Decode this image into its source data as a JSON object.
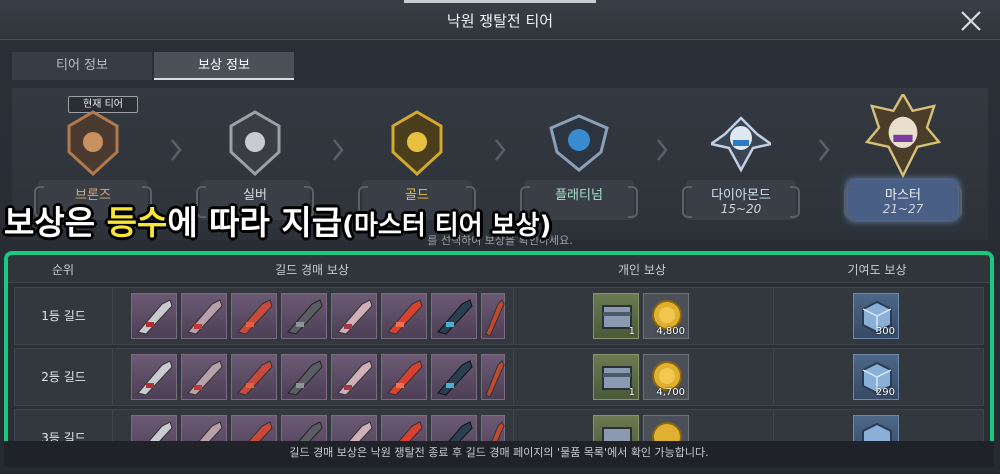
{
  "window": {
    "title": "낙원 쟁탈전 티어"
  },
  "tabs": [
    {
      "label": "티어 정보",
      "active": false
    },
    {
      "label": "보상 정보",
      "active": true
    }
  ],
  "tiers": {
    "current_badge": "현재 티어",
    "hint": "를 선택하여 보상을 확인하세요.",
    "items": [
      {
        "name": "브론즈",
        "range": "",
        "color": "#b07a4a"
      },
      {
        "name": "실버",
        "range": "",
        "color": "#9aa0a8"
      },
      {
        "name": "골드",
        "range": "",
        "color": "#d4a82a"
      },
      {
        "name": "플래티넘",
        "range": "",
        "color": "#4a9ad8"
      },
      {
        "name": "다이아몬드",
        "range": "15~20",
        "color": "#b8c8e0"
      },
      {
        "name": "마스터",
        "range": "21~27",
        "color": "#d8c078"
      }
    ]
  },
  "caption": {
    "part1": "보상은 ",
    "highlight": "등수",
    "part2": "에 따라 지급",
    "part3": "(마스터 티어 보상)"
  },
  "table": {
    "headers": {
      "rank": "순위",
      "auction": "길드 경매 보상",
      "personal": "개인 보상",
      "contribution": "기여도 보상"
    },
    "rows": [
      {
        "rank": "1등 길드",
        "personal_qty": [
          "1",
          "4,800"
        ],
        "contribution_qty": "300"
      },
      {
        "rank": "2등 길드",
        "personal_qty": [
          "1",
          "4,700"
        ],
        "contribution_qty": "290"
      },
      {
        "rank": "3등 길드",
        "personal_qty": [
          "",
          ""
        ],
        "contribution_qty": ""
      }
    ]
  },
  "footer": {
    "text": "길드 경매 보상은 낙원 쟁탈전 종료 후 길드 경매 페이지의 '물품 목록'에서 확인 가능합니다."
  },
  "colors": {
    "accent_frame": "#19c97d",
    "highlight_text": "#f7e53a"
  }
}
